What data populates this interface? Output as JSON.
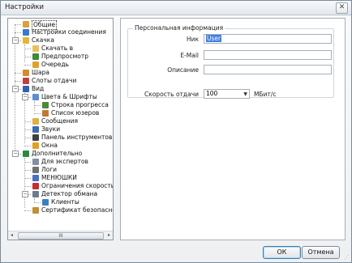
{
  "window": {
    "title": "Настройки",
    "close_icon": "close-icon"
  },
  "tree": {
    "items": [
      {
        "label": "Общие",
        "icon": "general-icon",
        "color": "#d9a13a",
        "selected": true
      },
      {
        "label": "Настройки соединения",
        "icon": "connection-icon",
        "color": "#3a78c8"
      },
      {
        "label": "Скачка",
        "icon": "download-icon",
        "color": "#e4b33b",
        "expander": "−"
      },
      {
        "label": "Скачать в",
        "icon": "folder-icon",
        "color": "#e8c15a"
      },
      {
        "label": "Предпросмотр",
        "icon": "preview-icon",
        "color": "#3b8a3b"
      },
      {
        "label": "Очередь",
        "icon": "queue-icon",
        "color": "#e0a030"
      },
      {
        "label": "Шара",
        "icon": "share-icon",
        "color": "#d58a2c"
      },
      {
        "label": "Слоты отдачи",
        "icon": "slots-icon",
        "color": "#c04040"
      },
      {
        "label": "Вид",
        "icon": "view-icon",
        "color": "#3060b0",
        "expander": "−"
      },
      {
        "label": "Цвета & Шрифты",
        "icon": "colors-fonts-icon",
        "color": "#5a8fd0",
        "expander": "−"
      },
      {
        "label": "Строка прогресса",
        "icon": "progress-bar-icon",
        "color": "#4a8a3a"
      },
      {
        "label": "Список юзеров",
        "icon": "users-list-icon",
        "color": "#c07838"
      },
      {
        "label": "Сообщения",
        "icon": "messages-icon",
        "color": "#e0b040"
      },
      {
        "label": "Звуки",
        "icon": "sounds-icon",
        "color": "#3a6ab0"
      },
      {
        "label": "Панель инструментов",
        "icon": "toolbar-icon",
        "color": "#404040"
      },
      {
        "label": "Окна",
        "icon": "windows-icon",
        "color": "#e0a020"
      },
      {
        "label": "Дополнительно",
        "icon": "advanced-icon",
        "color": "#2a8a40",
        "expander": "−"
      },
      {
        "label": "Для экспертов",
        "icon": "experts-icon",
        "color": "#8090a0"
      },
      {
        "label": "Логи",
        "icon": "logs-icon",
        "color": "#707070"
      },
      {
        "label": "МЕНЮШКИ",
        "icon": "menus-icon",
        "color": "#4a70c0"
      },
      {
        "label": "Ограничения скорости",
        "icon": "speed-limit-icon",
        "color": "#c03030"
      },
      {
        "label": "Детектор обмана",
        "icon": "cheat-detector-icon",
        "color": "#6a7a90",
        "expander": "−"
      },
      {
        "label": "Клиенты",
        "icon": "clients-icon",
        "color": "#3a80c0"
      },
      {
        "label": "Сертификат безопасности",
        "icon": "certificate-icon",
        "color": "#c09030"
      }
    ],
    "scroll_thumb": "III",
    "scroll_left": "◂",
    "scroll_right": "▸"
  },
  "personal": {
    "legend": "Персональная информация",
    "nick_label": "Ник",
    "nick_value": "User",
    "email_label": "E-Mail",
    "email_value": "",
    "desc_label": "Описание",
    "desc_value": "",
    "speed_label": "Скорость отдачи",
    "speed_value": "100",
    "speed_unit": "МБит/с"
  },
  "buttons": {
    "ok": "ОК",
    "cancel": "Отмена"
  }
}
